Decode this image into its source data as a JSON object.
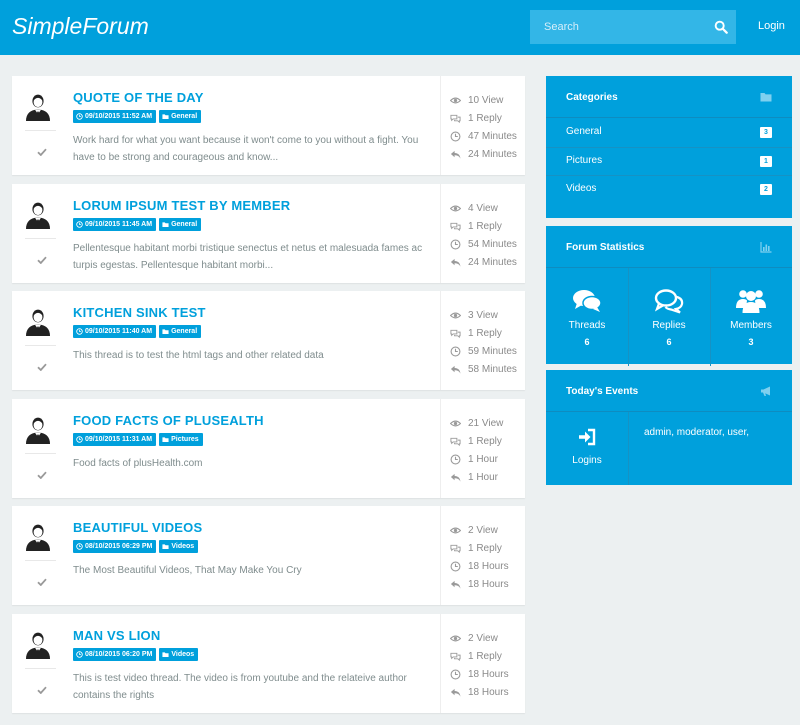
{
  "header": {
    "brand_light": "Simple",
    "brand_bold": "Forum",
    "search_placeholder": "Search",
    "login_label": "Login"
  },
  "threads": [
    {
      "title": "QUOTE OF THE DAY",
      "date": "09/10/2015 11:52 AM",
      "category": "General",
      "excerpt": "Work hard for what you want because it won't come to you without a fight. You have to be strong and courageous and know...",
      "views": "10 View",
      "replies": "1 Reply",
      "time": "47 Minutes",
      "last_reply": "24 Minutes"
    },
    {
      "title": "LORUM IPSUM TEST BY MEMBER",
      "date": "09/10/2015 11:45 AM",
      "category": "General",
      "excerpt": "Pellentesque habitant morbi tristique senectus et netus et malesuada fames ac turpis egestas. Pellentesque habitant morbi...",
      "views": "4 View",
      "replies": "1 Reply",
      "time": "54 Minutes",
      "last_reply": "24 Minutes"
    },
    {
      "title": "KITCHEN SINK TEST",
      "date": "09/10/2015 11:40 AM",
      "category": "General",
      "excerpt": "This thread is to test the html tags and other related data",
      "views": "3 View",
      "replies": "1 Reply",
      "time": "59 Minutes",
      "last_reply": "58 Minutes"
    },
    {
      "title": "FOOD FACTS OF PLUSEALTH",
      "date": "09/10/2015 11:31 AM",
      "category": "Pictures",
      "excerpt": "Food facts of plusHealth.com",
      "views": "21 View",
      "replies": "1 Reply",
      "time": "1 Hour",
      "last_reply": "1 Hour"
    },
    {
      "title": "BEAUTIFUL VIDEOS",
      "date": "08/10/2015 06:29 PM",
      "category": "Videos",
      "excerpt": "The Most Beautiful Videos, That May Make You Cry",
      "views": "2 View",
      "replies": "1 Reply",
      "time": "18 Hours",
      "last_reply": "18 Hours"
    },
    {
      "title": "MAN VS LION",
      "date": "08/10/2015 06:20 PM",
      "category": "Videos",
      "excerpt": "This is test video thread. The video is from youtube and the relateive author contains the rights",
      "views": "2 View",
      "replies": "1 Reply",
      "time": "18 Hours",
      "last_reply": "18 Hours"
    }
  ],
  "categories": {
    "title": "Categories",
    "items": [
      {
        "label": "General",
        "count": "3"
      },
      {
        "label": "Pictures",
        "count": "1"
      },
      {
        "label": "Videos",
        "count": "2"
      }
    ]
  },
  "forum_stats": {
    "title": "Forum Statistics",
    "threads_label": "Threads",
    "threads_count": "6",
    "replies_label": "Replies",
    "replies_count": "6",
    "members_label": "Members",
    "members_count": "3"
  },
  "events": {
    "title": "Today's Events",
    "logins_label": "Logins",
    "users_text": "admin, moderator, user,"
  },
  "colors": {
    "primary": "#00a0dc",
    "background": "#ecf0f1"
  }
}
